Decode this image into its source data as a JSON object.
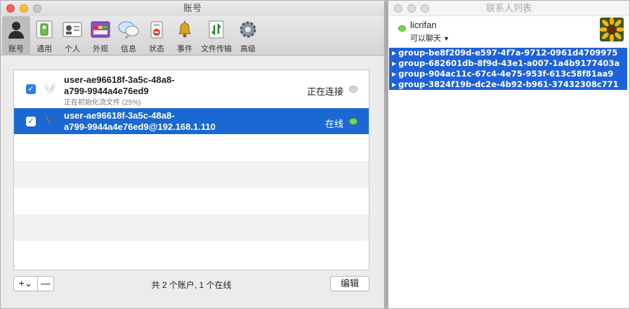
{
  "accounts_window": {
    "title": "账号",
    "toolbar": [
      {
        "label": "账号",
        "icon": "account-silhouette-icon"
      },
      {
        "label": "通用",
        "icon": "general-switch-icon"
      },
      {
        "label": "个人",
        "icon": "personal-card-icon"
      },
      {
        "label": "外观",
        "icon": "appearance-palette-icon"
      },
      {
        "label": "信息",
        "icon": "message-bubble-icon"
      },
      {
        "label": "状态",
        "icon": "status-lock-icon"
      },
      {
        "label": "事件",
        "icon": "event-bell-icon"
      },
      {
        "label": "文件传输",
        "icon": "file-transfer-icon"
      },
      {
        "label": "高级",
        "icon": "advanced-gear-icon"
      }
    ],
    "accounts": [
      {
        "checked": true,
        "name_line1": "user-ae96618f-3a5c-48a8-",
        "name_line2": "a799-9944a4e76ed9",
        "subtitle": "正在初始化流文件 (25%)",
        "progress": 0.25,
        "status": "正在连接",
        "status_color": "#d6d6d6"
      },
      {
        "checked": true,
        "name_line1": "user-ae96618f-3a5c-48a8-",
        "name_line2": "a799-9944a4e76ed9@192.168.1.110",
        "status": "在线",
        "status_color": "#7ed64a",
        "selected": true
      }
    ],
    "bottom": {
      "add_label": "+⌄",
      "remove_label": "—",
      "summary": "共 2 个账户, 1 个在线",
      "edit_label": "编辑"
    },
    "selection_color": "#1a68d1"
  },
  "contacts_window": {
    "title": "联系人列表",
    "me": {
      "name": "licrifan",
      "status": "可以聊天",
      "status_color": "#7ed64a",
      "avatar_icon": "sunflower-avatar-icon"
    },
    "groups": [
      "group-be8f209d-e597-4f7a-9712-0961d4709975",
      "group-682601db-8f9d-43e1-a007-1a4b9177403a",
      "group-904ac11c-67c4-4e75-953f-613c58f81aa9",
      "group-3824f19b-dc2e-4b92-b961-37432308c771"
    ],
    "group_color": "#1f62d8"
  }
}
